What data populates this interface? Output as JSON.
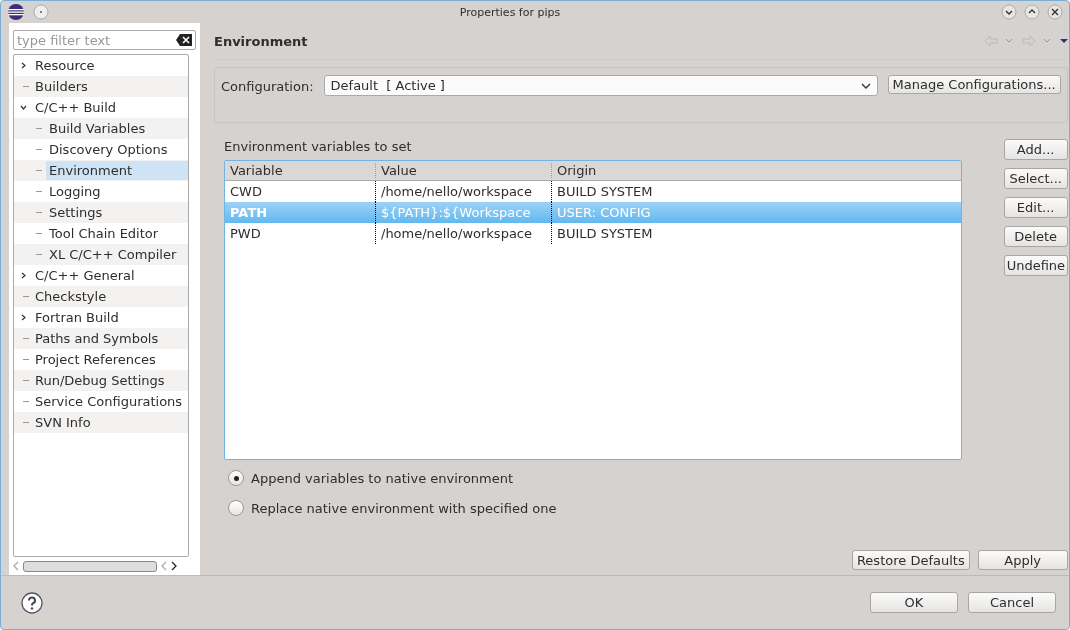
{
  "window": {
    "title": "Properties for pips"
  },
  "filter": {
    "placeholder": "type filter text"
  },
  "tree": [
    {
      "label": "Resource",
      "kind": "branch",
      "expanded": false,
      "selected": false
    },
    {
      "label": "Builders",
      "kind": "leaf",
      "selected": false
    },
    {
      "label": "C/C++ Build",
      "kind": "branch",
      "expanded": true,
      "selected": false,
      "children": [
        {
          "label": "Build Variables",
          "kind": "leaf",
          "selected": false
        },
        {
          "label": "Discovery Options",
          "kind": "leaf",
          "selected": false
        },
        {
          "label": "Environment",
          "kind": "leaf",
          "selected": true
        },
        {
          "label": "Logging",
          "kind": "leaf",
          "selected": false
        },
        {
          "label": "Settings",
          "kind": "leaf",
          "selected": false
        },
        {
          "label": "Tool Chain Editor",
          "kind": "leaf",
          "selected": false
        },
        {
          "label": "XL C/C++ Compiler",
          "kind": "leaf",
          "selected": false
        }
      ]
    },
    {
      "label": "C/C++ General",
      "kind": "branch",
      "expanded": false,
      "selected": false
    },
    {
      "label": "Checkstyle",
      "kind": "leaf",
      "selected": false
    },
    {
      "label": "Fortran Build",
      "kind": "branch",
      "expanded": false,
      "selected": false
    },
    {
      "label": "Paths and Symbols",
      "kind": "leaf",
      "selected": false
    },
    {
      "label": "Project References",
      "kind": "leaf",
      "selected": false
    },
    {
      "label": "Run/Debug Settings",
      "kind": "leaf",
      "selected": false
    },
    {
      "label": "Service Configurations",
      "kind": "leaf",
      "selected": false
    },
    {
      "label": "SVN Info",
      "kind": "leaf",
      "selected": false
    }
  ],
  "page": {
    "title": "Environment"
  },
  "configuration": {
    "label": "Configuration:",
    "value": "Default  [ Active ]",
    "button": "Manage Configurations..."
  },
  "table": {
    "caption": "Environment variables to set",
    "columns": [
      "Variable",
      "Value",
      "Origin"
    ],
    "rows": [
      {
        "cells": [
          "CWD",
          "/home/nello/workspace",
          "BUILD SYSTEM"
        ],
        "selected": false
      },
      {
        "cells": [
          "PATH",
          "${PATH}:${Workspace",
          "USER: CONFIG"
        ],
        "selected": true
      },
      {
        "cells": [
          "PWD",
          "/home/nello/workspace",
          "BUILD SYSTEM"
        ],
        "selected": false
      }
    ]
  },
  "side_buttons": [
    "Add...",
    "Select...",
    "Edit...",
    "Delete",
    "Undefine"
  ],
  "options": [
    {
      "label": "Append variables to native environment",
      "selected": true
    },
    {
      "label": "Replace native environment with specified one",
      "selected": false
    }
  ],
  "page_buttons": [
    "Restore Defaults",
    "Apply"
  ],
  "dialog_buttons": [
    "OK",
    "Cancel"
  ]
}
